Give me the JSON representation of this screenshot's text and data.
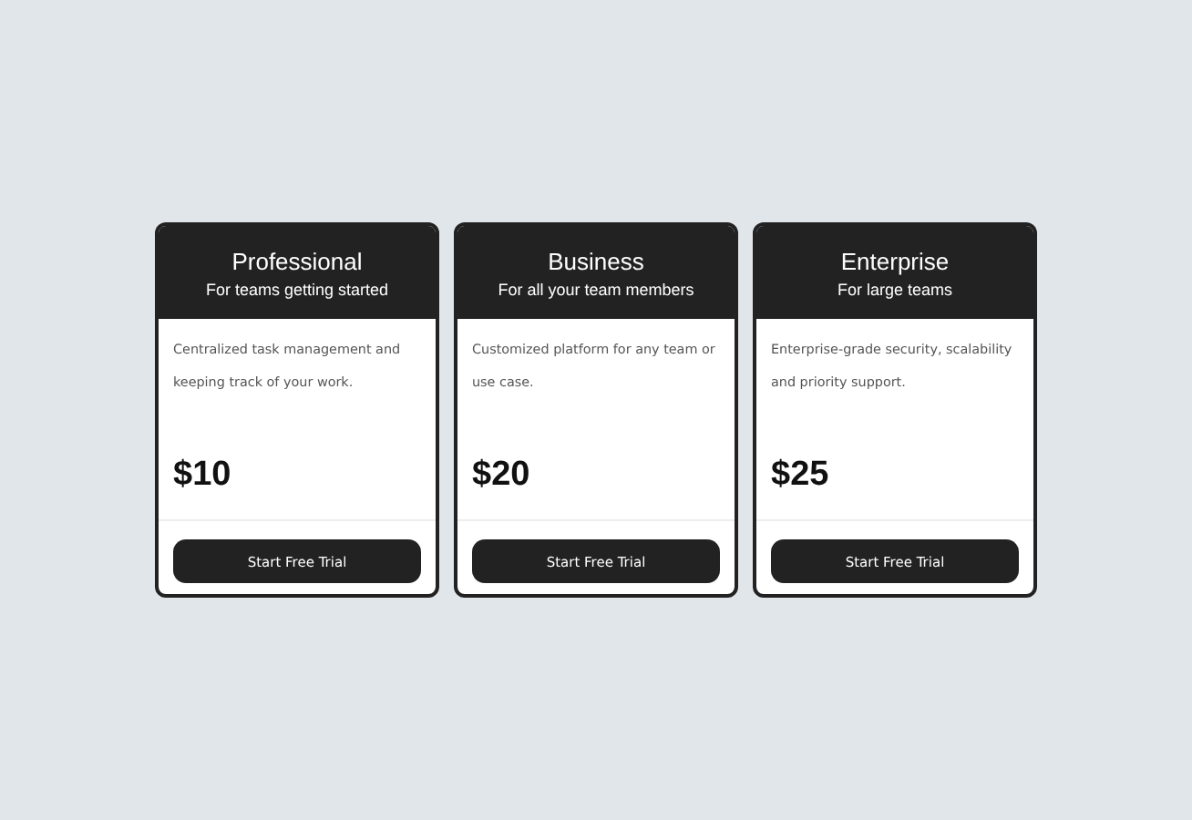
{
  "plans": [
    {
      "name": "Professional",
      "tagline": "For teams getting started",
      "description": "Centralized task management and keeping track of your work.",
      "price": "$10",
      "button": "Start Free Trial"
    },
    {
      "name": "Business",
      "tagline": "For all your team members",
      "description": "Customized platform for any team or use case.",
      "price": "$20",
      "button": "Start Free Trial"
    },
    {
      "name": "Enterprise",
      "tagline": "For large teams",
      "description": "Enterprise-grade security, scalability and priority support.",
      "price": "$25",
      "button": "Start Free Trial"
    }
  ]
}
